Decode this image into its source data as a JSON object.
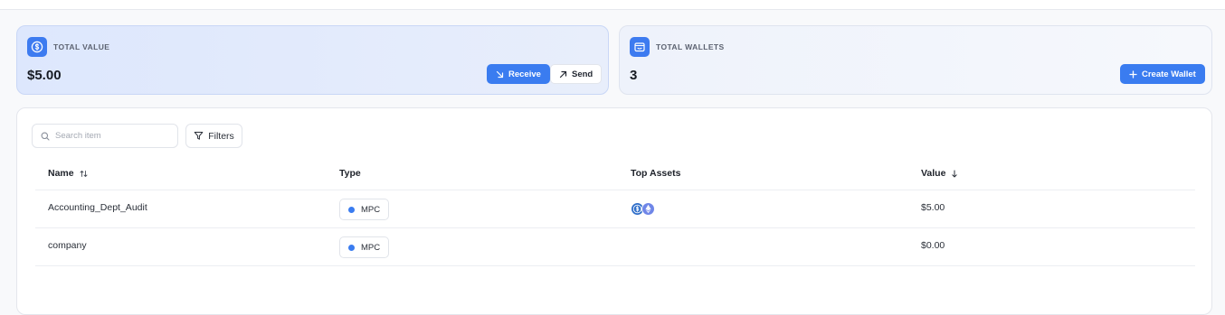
{
  "cards": {
    "total_value": {
      "label": "TOTAL VALUE",
      "amount": "$5.00",
      "receive_label": "Receive",
      "send_label": "Send"
    },
    "total_wallets": {
      "label": "TOTAL WALLETS",
      "count": "3",
      "create_label": "Create Wallet"
    }
  },
  "toolbar": {
    "search_placeholder": "Search item",
    "filters_label": "Filters"
  },
  "table": {
    "headers": {
      "name": "Name",
      "type": "Type",
      "top_assets": "Top Assets",
      "value": "Value"
    },
    "rows": [
      {
        "name": "Accounting_Dept_Audit",
        "type": "MPC",
        "assets": [
          "usdc-icon",
          "eth-icon"
        ],
        "value": "$5.00"
      },
      {
        "name": "company",
        "type": "MPC",
        "assets": [],
        "value": "$0.00"
      }
    ]
  },
  "colors": {
    "accent": "#3a7cf0",
    "value_card_bg": "#dde7fd"
  }
}
